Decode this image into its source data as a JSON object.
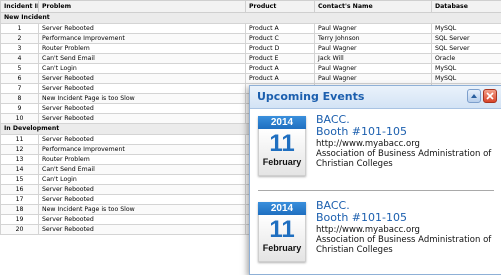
{
  "grid": {
    "columns": [
      "Incident ID",
      "Problem",
      "Product",
      "Contact's Name",
      "Database"
    ],
    "groups": [
      {
        "name": "New Incident",
        "rows": [
          [
            "1",
            "Server Rebooted",
            "Product A",
            "Paul Wagner",
            "MySQL"
          ],
          [
            "2",
            "Performance Improvement",
            "Product C",
            "Terry Johnson",
            "SQL Server"
          ],
          [
            "3",
            "Router Problem",
            "Product D",
            "Paul Wagner",
            "SQL Server"
          ],
          [
            "4",
            "Can't Send Email",
            "Product E",
            "Jack Will",
            "Oracle"
          ],
          [
            "5",
            "Can't Login",
            "Product A",
            "Paul Wagner",
            "MySQL"
          ],
          [
            "6",
            "Server Rebooted",
            "Product A",
            "Paul Wagner",
            "MySQL"
          ],
          [
            "7",
            "Server Rebooted",
            "",
            "",
            ""
          ],
          [
            "8",
            "New Incident Page is too Slow",
            "",
            "",
            ""
          ],
          [
            "9",
            "Server Rebooted",
            "",
            "",
            ""
          ],
          [
            "10",
            "Server Rebooted",
            "",
            "",
            ""
          ]
        ]
      },
      {
        "name": "In Development",
        "rows": [
          [
            "11",
            "Server Rebooted",
            "",
            "",
            ""
          ],
          [
            "12",
            "Performance Improvement",
            "",
            "",
            ""
          ],
          [
            "13",
            "Router Problem",
            "",
            "",
            ""
          ],
          [
            "14",
            "Can't Send Email",
            "",
            "",
            ""
          ],
          [
            "15",
            "Can't Login",
            "",
            "",
            ""
          ],
          [
            "16",
            "Server Rebooted",
            "",
            "",
            ""
          ],
          [
            "17",
            "Server Rebooted",
            "",
            "",
            ""
          ],
          [
            "18",
            "New Incident Page is too Slow",
            "",
            "",
            ""
          ],
          [
            "19",
            "Server Rebooted",
            "",
            "",
            ""
          ],
          [
            "20",
            "Server Rebooted",
            "",
            "",
            ""
          ]
        ]
      }
    ]
  },
  "popup": {
    "title": "Upcoming Events",
    "minimize_icon": "minimize-icon",
    "close_icon": "close-icon",
    "events": [
      {
        "year": "2014",
        "day": "11",
        "month": "February",
        "title": "BACC.",
        "booth": "Booth #101-105",
        "url": "http://www.myabacc.org",
        "org": "Association of Business Administration of Christian Colleges"
      },
      {
        "year": "2014",
        "day": "11",
        "month": "February",
        "title": "BACC.",
        "booth": "Booth #101-105",
        "url": "http://www.myabacc.org",
        "org": "Association of Business Administration of Christian Colleges"
      }
    ]
  },
  "colors": {
    "accent": "#1c5fae",
    "calendar_blue": "#1f6fc0",
    "close_red": "#d9442a"
  }
}
